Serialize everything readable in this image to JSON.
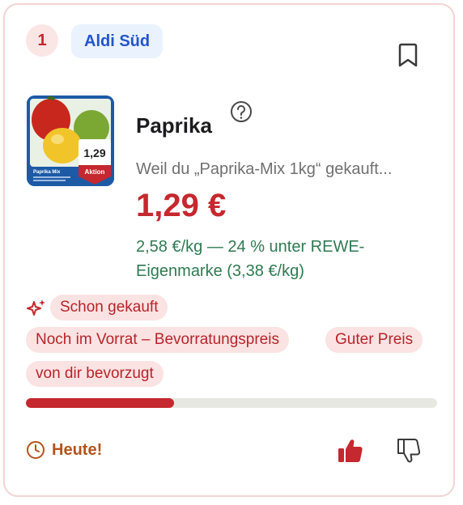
{
  "card": {
    "rank": "1",
    "store": "Aldi Süd",
    "product": {
      "title": "Paprika",
      "reason": "Weil du „Paprika-Mix 1kg“ gekauft...",
      "price": "1,29 €",
      "comparison": "2,58 €/kg — 24 % unter REWE-Eigenmarke (3,38 €/kg)",
      "image": {
        "price_tag": "1,29",
        "tag_label": "Aktion",
        "name": "Paprika Mix"
      }
    },
    "tags": [
      "Schon gekauft",
      "Noch im Vorrat – Bevorratungspreis",
      "Guter Preis",
      "von dir bevorzugt"
    ],
    "progress": 0.36,
    "deadline": "Heute!",
    "icons": [
      "bookmark-icon",
      "help-icon",
      "sparkle-icon",
      "clock-icon",
      "thumbs-up-icon",
      "thumbs-down-icon"
    ],
    "colors": {
      "accent": "#c5282e",
      "store_text": "#2454c9",
      "store_bg": "#eaf2fe",
      "savings": "#2f7a52",
      "deadline": "#b2541b",
      "chip_bg": "#fbe3e3"
    }
  }
}
